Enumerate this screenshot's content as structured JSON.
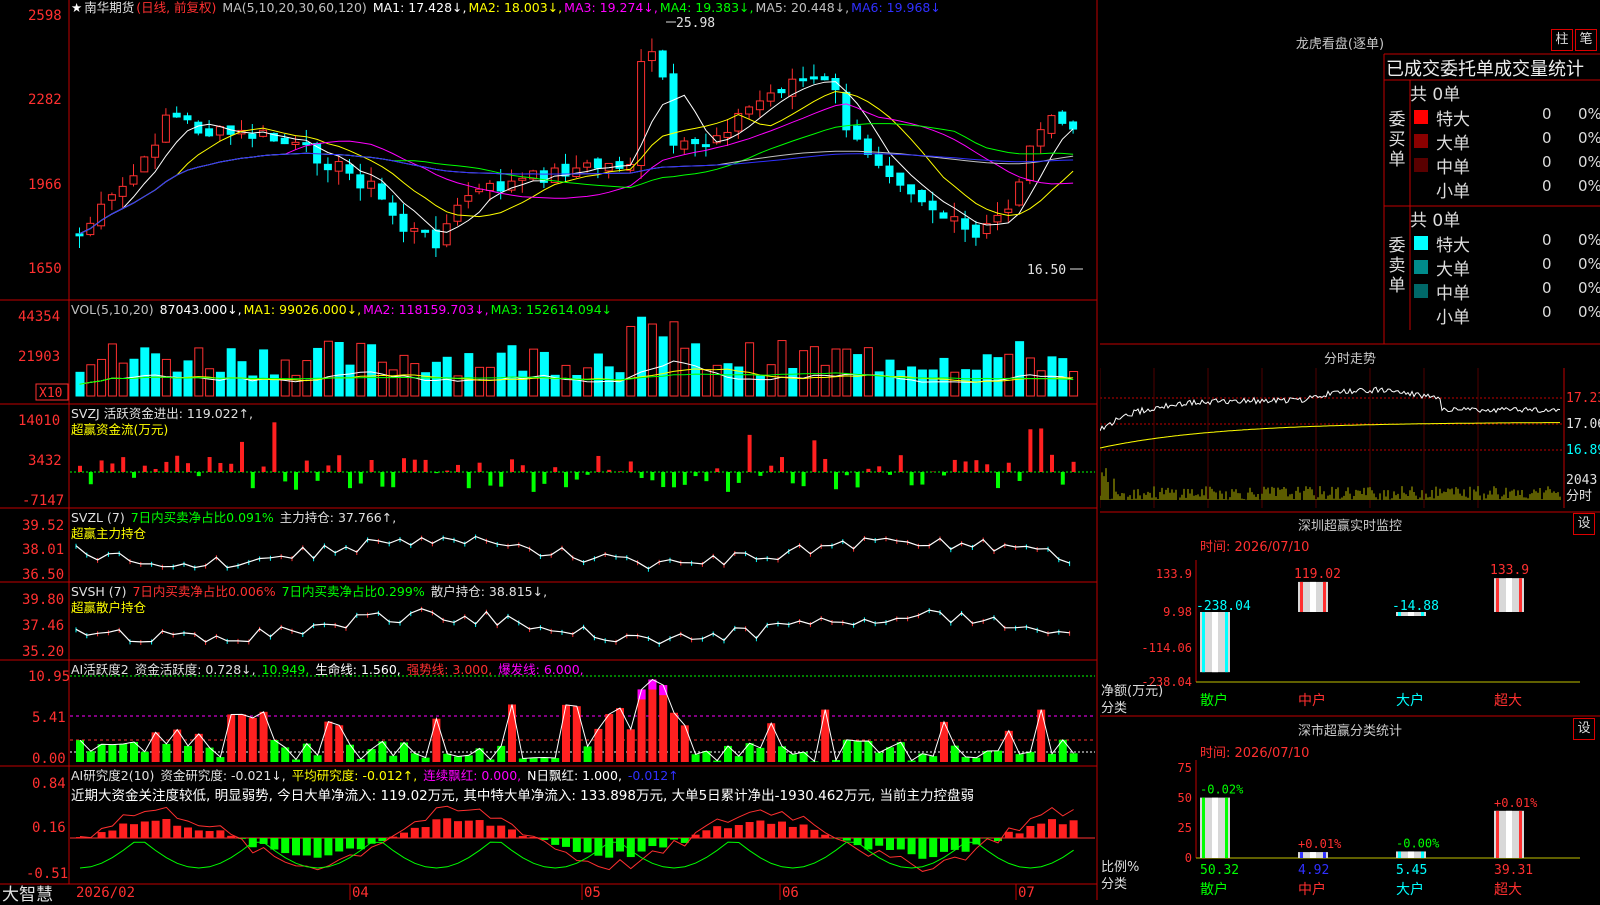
{
  "main": {
    "header_k": {
      "star": "★",
      "title": "南华期货",
      "mode": "(日线, 前复权)",
      "ma_label": "MA(5,10,20,30,60,120)",
      "ma1": "MA1: 17.428↓,",
      "ma2": "MA2: 18.003↓,",
      "ma3": "MA3: 19.274↓,",
      "ma4": "MA4: 19.383↓,",
      "ma5": "MA5: 20.448↓,",
      "ma6": "MA6: 19.968↓",
      "high_label": "25.98",
      "low_label": "16.50"
    },
    "header_vol": {
      "label": "VOL(5,10,20)",
      "v": "87043.000↓,",
      "ma1": "MA1: 99026.000↓,",
      "ma2": "MA2: 118159.703↓,",
      "ma3": "MA3: 152614.094↓"
    },
    "header_svzj": {
      "label": "SVZJ  活跃资金进出: 119.022↑,",
      "sub": "超赢资金流(万元)"
    },
    "header_svzl": {
      "label": "SVZL (7)",
      "a": "7日内买卖净占比0.091%",
      "b": "主力持仓: 37.766↑,",
      "sub": "超赢主力持仓"
    },
    "header_svsh": {
      "label": "SVSH (7)",
      "a": "7日内买卖净占比0.006%",
      "b": "7日内买卖净占比0.299%",
      "c": "散户持仓: 38.815↓,",
      "sub": "超赢散户持仓"
    },
    "header_ai1": {
      "label": "AI活跃度2",
      "a": "资金活跃度: 0.728↓,",
      "b": "10.949,",
      "c": "生命线: 1.560,",
      "d": "强势线: 3.000,",
      "e": "爆发线: 6.000,"
    },
    "header_ai2": {
      "label": "AI研究度2(10)",
      "a": "资金研究度: -0.021↓,",
      "b": "平均研究度: -0.012↑,",
      "c": "连续飘红: 0.000,",
      "d": "N日飘红: 1.000,",
      "e": "-0.012↑"
    },
    "comment": "近期大资金关注度较低, 明显弱势, 今日大单净流入: 119.02万元, 其中特大单净流入: 133.898万元, 大单5日累计净出-1930.462万元, 当前主力控盘弱",
    "axes": {
      "price": [
        "2598",
        "2282",
        "1966",
        "1650"
      ],
      "vol": [
        "44354",
        "21903",
        "X10"
      ],
      "svzj": [
        "14010",
        "3432",
        "-7147"
      ],
      "svzl": [
        "39.52",
        "38.01",
        "36.50"
      ],
      "svsh": [
        "39.80",
        "37.46",
        "35.20"
      ],
      "ai1": [
        "10.95",
        "5.41",
        "0.00"
      ],
      "ai2": [
        "0.84",
        "0.16",
        "-0.51"
      ]
    },
    "bottom": {
      "brand": "大智慧",
      "dates": [
        "2026/02",
        "04",
        "05",
        "06",
        "07"
      ]
    }
  },
  "side": {
    "dragon": {
      "title": "龙虎看盘(逐单)",
      "btn_bar": "柱",
      "btn_pen": "笔",
      "subtitle": "已成交委托单成交量统计",
      "buy_label": "委买单",
      "sell_label": "委卖单",
      "buy_total": "共 0单",
      "sell_total": "共 0单",
      "buy_rows": [
        {
          "name": "特大",
          "count": "0",
          "pct": "0%",
          "color": "#ff0000"
        },
        {
          "name": "大单",
          "count": "0",
          "pct": "0%",
          "color": "#8b0000"
        },
        {
          "name": "中单",
          "count": "0",
          "pct": "0%",
          "color": "#5a0000"
        },
        {
          "name": "小单",
          "count": "0",
          "pct": "0%",
          "color": "#000000"
        }
      ],
      "sell_rows": [
        {
          "name": "特大",
          "count": "0",
          "pct": "0%",
          "color": "#00ffff"
        },
        {
          "name": "大单",
          "count": "0",
          "pct": "0%",
          "color": "#008b8b"
        },
        {
          "name": "中单",
          "count": "0",
          "pct": "0%",
          "color": "#006868"
        },
        {
          "name": "小单",
          "count": "0",
          "pct": "0%",
          "color": "#000000"
        }
      ]
    },
    "intraday": {
      "title": "分时走势",
      "price_labels": [
        "17.23",
        "17.06",
        "16.89"
      ],
      "vol_label": "2043",
      "vol_unit": "分时"
    },
    "sz_monitor": {
      "title": "深圳超赢实时监控",
      "btn": "设",
      "time": "时间: 2026/07/10",
      "yaxis": [
        "133.9",
        "9.98",
        "-114.06",
        "-238.04"
      ],
      "unit1": "净额(万元)",
      "unit2": "分类",
      "categories": [
        "散户",
        "中户",
        "大户",
        "超大"
      ],
      "values": [
        -238.04,
        119.02,
        -14.88,
        133.9
      ],
      "value_labels": [
        "-238.04",
        "119.02",
        "-14.88",
        "133.9"
      ]
    },
    "sz_class": {
      "title": "深市超赢分类统计",
      "btn": "设",
      "time": "时间: 2026/07/10",
      "yaxis": [
        "75",
        "50",
        "25",
        "0"
      ],
      "unit1": "比例%",
      "unit2": "分类",
      "categories": [
        "散户",
        "中户",
        "大户",
        "超大"
      ],
      "values": [
        50.32,
        4.92,
        5.45,
        39.31
      ],
      "value_labels": [
        "50.32",
        "4.92",
        "5.45",
        "39.31"
      ],
      "change_labels": [
        "-0.02%",
        "+0.01%",
        "-0.00%",
        "+0.01%"
      ]
    }
  }
}
